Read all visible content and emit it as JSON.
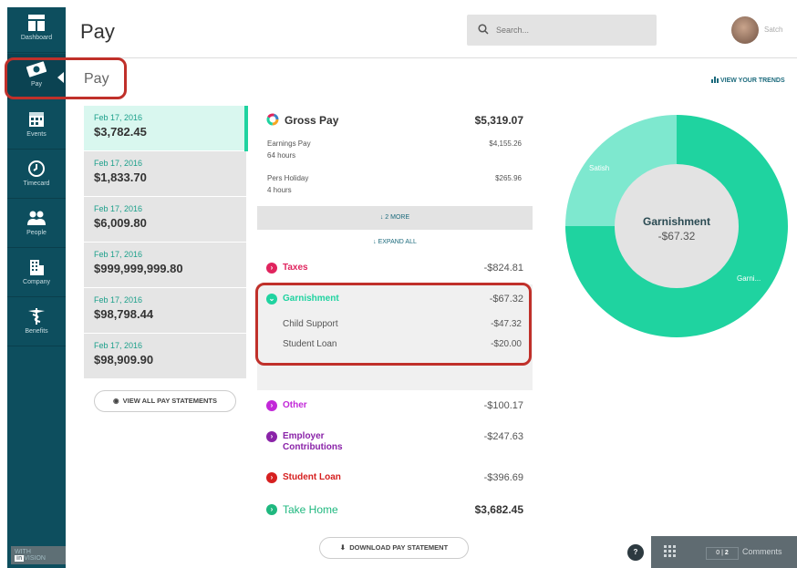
{
  "sidebar": {
    "items": [
      {
        "label": "Dashboard",
        "icon": "dashboard-icon"
      },
      {
        "label": "Pay",
        "icon": "money-icon"
      },
      {
        "label": "Events",
        "icon": "calendar-icon"
      },
      {
        "label": "Timecard",
        "icon": "clock-icon"
      },
      {
        "label": "People",
        "icon": "people-icon"
      },
      {
        "label": "Company",
        "icon": "building-icon"
      },
      {
        "label": "Benefits",
        "icon": "caduceus-icon"
      }
    ],
    "active": "Pay",
    "footer_prefix": "WITH",
    "footer_brand": "in",
    "footer_suffix": "VISION"
  },
  "header": {
    "title": "Pay",
    "search_placeholder": "Search...",
    "user_name": "Satch"
  },
  "section_title": "Pay",
  "trends_link": "VIEW YOUR TRENDS",
  "statements": [
    {
      "date": "Feb 17, 2016",
      "amount": "$3,782.45"
    },
    {
      "date": "Feb 17, 2016",
      "amount": "$1,833.70"
    },
    {
      "date": "Feb 17, 2016",
      "amount": "$6,009.80"
    },
    {
      "date": "Feb 17, 2016",
      "amount": "$999,999,999.80"
    },
    {
      "date": "Feb 17, 2016",
      "amount": "$98,798.44"
    },
    {
      "date": "Feb 17, 2016",
      "amount": "$98,909.90"
    }
  ],
  "view_all_label": "VIEW ALL PAY STATEMENTS",
  "detail": {
    "gross": {
      "label": "Gross Pay",
      "value": "$5,319.07"
    },
    "earnings": [
      {
        "label": "Earnings Pay",
        "sub": "64 hours",
        "value": "$4,155.26"
      },
      {
        "label": "Pers Holiday",
        "sub": "4 hours",
        "value": "$265.96"
      }
    ],
    "more_label": "2 MORE",
    "expand_label": "EXPAND ALL",
    "taxes": {
      "label": "Taxes",
      "value": "-$824.81"
    },
    "garnishment": {
      "label": "Garnishment",
      "value": "-$67.32",
      "items": [
        {
          "label": "Child Support",
          "value": "-$47.32"
        },
        {
          "label": "Student Loan",
          "value": "-$20.00"
        }
      ]
    },
    "other": {
      "label": "Other",
      "value": "-$100.17"
    },
    "employer": {
      "label_line1": "Employer",
      "label_line2": "Contributions",
      "value": "-$247.63"
    },
    "student_loan": {
      "label": "Student Loan",
      "value": "-$396.69"
    },
    "take_home": {
      "label": "Take Home",
      "value": "$3,682.45"
    },
    "download_label": "DOWNLOAD PAY STATEMENT"
  },
  "donut": {
    "center_title": "Garnishment",
    "center_value": "-$67.32",
    "slices": [
      {
        "label": "Satish",
        "fraction": 0.25,
        "color": "#7ee8cf"
      },
      {
        "label": "Garni...",
        "fraction": 0.75,
        "color": "#1fd3a0"
      }
    ]
  },
  "colors": {
    "sidebar": "#0d4e5e",
    "accent": "#1fd3a0",
    "taxes": "#e0245e",
    "garnishment": "#1fd3a0",
    "other": "#c228d8",
    "employer": "#8a23a8",
    "student_loan": "#d62020",
    "take_home": "#1fb87f",
    "highlight": "#c0302a"
  },
  "footer": {
    "help_label": "?",
    "comment_count": "2",
    "comment_zero": "0",
    "comments_label": "Comments"
  }
}
